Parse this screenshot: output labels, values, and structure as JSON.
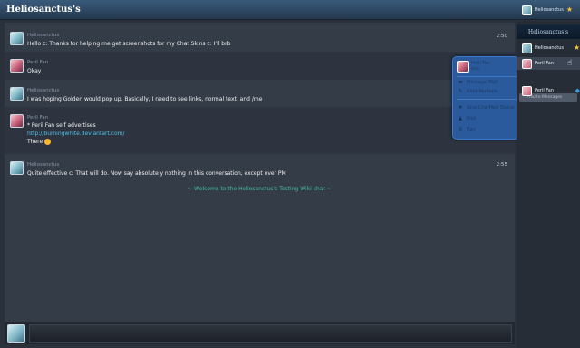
{
  "header": {
    "title": "Heliosanctus's",
    "user_name": "Heliosanctus"
  },
  "messages": [
    {
      "name": "Heliosanctus",
      "text": "Hello c: Thanks for helping me get screenshots for my Chat Skins c: I'll brb",
      "time": "2:50"
    },
    {
      "name": "Peril Fan",
      "text": "Okay"
    },
    {
      "name": "Heliosanctus",
      "text": "I was hoping Golden would pop up. Basically, I need to see links, normal text, and /me"
    },
    {
      "name": "Peril Fan",
      "line1": "* Peril Fan self advertises",
      "link": "http://burningwhite.deviantart.com/",
      "line3": "There"
    },
    {
      "name": "Heliosanctus",
      "text": "Quite effective c: That will do. Now say absolutely nothing in this conversation, except over PM",
      "time": "2:55"
    }
  ],
  "welcome": "~ Welcome to the Heliosanctus's Testing Wiki chat ~",
  "popup": {
    "name": "Peril Fan",
    "role": "User",
    "items": [
      "Message Wall",
      "Contributions",
      "Give ChatMod Status",
      "Kick",
      "Ban"
    ]
  },
  "sidebar": {
    "banner": "Heliosanctus's",
    "users": [
      "Heliosanctus",
      "Peril Fan"
    ],
    "private_label": "Private Messages",
    "private_users": [
      "Peril Fan"
    ]
  },
  "input": {
    "value": ""
  },
  "icons": {
    "star": "star-icon",
    "cursor": "hand-pointer-icon",
    "popup": [
      "message-wall-icon",
      "pencil-icon",
      "star-icon",
      "warning-icon",
      "ban-icon"
    ]
  },
  "colors": {
    "accent": "#4fc0e8",
    "welcome": "#3fbf9f",
    "popup": "#2a5a9c"
  }
}
